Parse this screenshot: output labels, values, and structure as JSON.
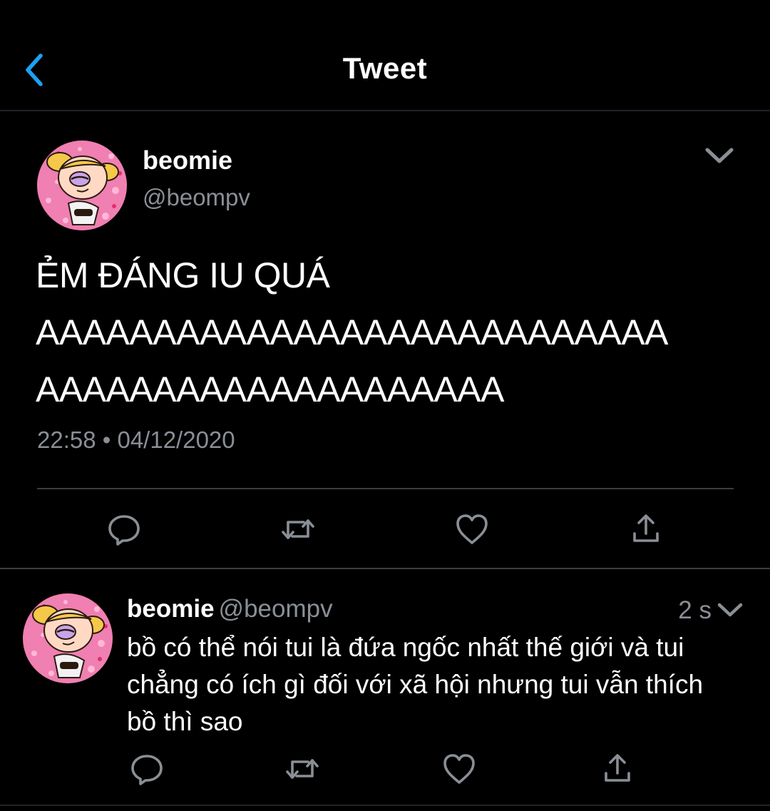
{
  "header": {
    "title": "Tweet",
    "back_icon": "chevron-left-icon",
    "accent": "#1da1f2"
  },
  "main_tweet": {
    "name": "beomie",
    "handle": "@beompv",
    "text_lines": [
      "ẺM ĐÁNG IU QUÁ",
      "AAAAAAAAAAAAAAAAAAAAAAAAAAA",
      "AAAAAAAAAAAAAAAAAAAA"
    ],
    "timestamp": "22:58 • 04/12/2020",
    "actions": [
      "reply-icon",
      "retweet-icon",
      "like-icon",
      "share-icon"
    ]
  },
  "reply_tweet": {
    "name": "beomie",
    "handle": "@beompv",
    "time": "2 s",
    "text": "bồ có thể nói tui là đứa ngốc nhất thế giới và tui chẳng có ích gì đối với xã hội nhưng tui vẫn thích bồ thì sao",
    "actions": [
      "reply-icon",
      "retweet-icon",
      "like-icon",
      "share-icon"
    ]
  },
  "colors": {
    "background": "#000000",
    "secondary_text": "#8a8f96",
    "icon": "#8a8f96",
    "divider": "#3a3d42"
  }
}
